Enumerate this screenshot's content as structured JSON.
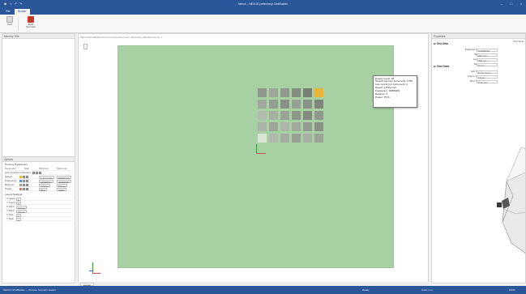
{
  "app": {
    "title": "Nexus – NEXUS preliminary ShotBuilder",
    "colors": {
      "titlebar": "#2b579a",
      "stage": "#a7d0a3",
      "accent": "#e8b53a"
    }
  },
  "tabs": [
    {
      "label": "File",
      "active": false
    },
    {
      "label": "Builder",
      "active": true
    }
  ],
  "ribbon": {
    "buttons": [
      {
        "label": "Grid",
        "icon": "grid-icon"
      },
      {
        "label": "Build Scenario",
        "icon": "build-icon"
      }
    ]
  },
  "left_panel": {
    "title": "Memory Tree",
    "options_title": "Options",
    "options_subtitle": "Process Parameters",
    "options_headers": [
      "Parameter",
      "Step",
      "Minimum",
      "Maximum"
    ],
    "options_rows": [
      {
        "name": "Use constant Increment",
        "step": "",
        "min": "",
        "max": ""
      },
      {
        "name": "Speed",
        "step": "",
        "min": "1.17 m/min",
        "max": "2000mm/s"
      },
      {
        "name": "Frequency",
        "step": "",
        "min": "100000Hz",
        "max": "200000Hz"
      },
      {
        "name": "Defocus",
        "step": "",
        "min": "-5.9mm",
        "max": "5.9mm"
      },
      {
        "name": "Power",
        "step": "",
        "min": "50%",
        "max": "100%"
      }
    ],
    "layout_title": "Layout Settings",
    "layout_rows": [
      {
        "label": "X Count",
        "value": "6"
      },
      {
        "label": "Y Count",
        "value": "5"
      },
      {
        "label": "X Pitch",
        "value": "3.0mm"
      },
      {
        "label": "Y Pitch",
        "value": "3.0mm"
      },
      {
        "label": "X Size",
        "value": "2"
      },
      {
        "label": "Y Size",
        "value": "2"
      }
    ]
  },
  "viewport": {
    "path": "NEXUS/ShotBuilder/Process Scenarios/Laser parameter grid/Material test 1",
    "grid_cols": 6,
    "grid_rows": 5,
    "highlighted_cell": {
      "col": 5,
      "row": 0
    },
    "tooltip": [
      "Energy Level: 48",
      "Speed (mm/min increment): 1750",
      "Line count (mm increment): 2",
      "Speed: 1750 mm/s",
      "Frequency: 190000Hz",
      "Defocus: 3",
      "Power: 75 %"
    ]
  },
  "right_panel": {
    "title": "Properties",
    "right_label": "Part View",
    "section1": "Grid Data",
    "section1_rows": [
      {
        "label": "Preferred Size",
        "value": "0.0000001"
      },
      {
        "label": "Width",
        "value": "200 mm"
      },
      {
        "label": "Length",
        "value": "200 mm"
      },
      {
        "label": "Depth",
        "value": "0 mm"
      }
    ],
    "section2": "Shot Stats",
    "section2_rows": [
      {
        "label": "Job Time",
        "value": "5 min 2 sec"
      },
      {
        "label": "Frame Time",
        "value": "13 sec"
      },
      {
        "label": "Shot Time",
        "value": "0.11 sec"
      }
    ]
  },
  "status": {
    "left": "NEXUS ShotBuilder — Process Scenario loaded",
    "center": "Ready",
    "right": "Units: mm",
    "zoom": "100%"
  },
  "viewport_tab": {
    "label": "Layout"
  }
}
